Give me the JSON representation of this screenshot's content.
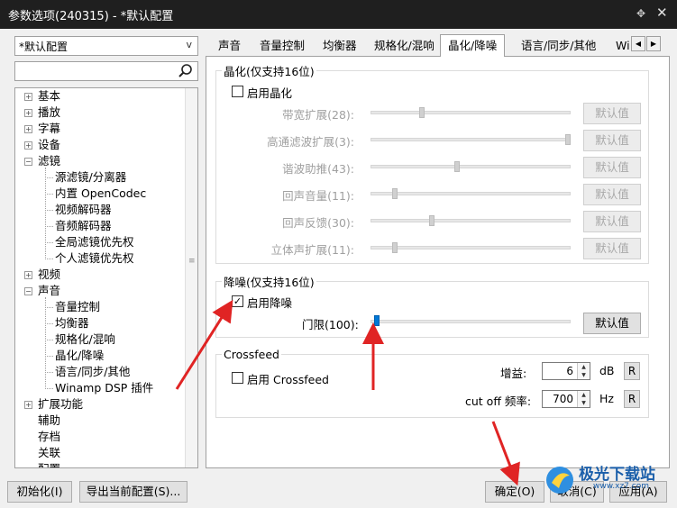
{
  "window": {
    "title": "参数选项(240315) - *默认配置",
    "pin_icon": "pin-icon",
    "close_icon": "close-icon"
  },
  "preset": {
    "value": "*默认配置"
  },
  "tree": {
    "items": [
      {
        "label": "基本",
        "expand": "+"
      },
      {
        "label": "播放",
        "expand": "+"
      },
      {
        "label": "字幕",
        "expand": "+"
      },
      {
        "label": "设备",
        "expand": "+"
      },
      {
        "label": "滤镜",
        "expand": "-"
      },
      {
        "label": "源滤镜/分离器"
      },
      {
        "label": "内置 OpenCodec"
      },
      {
        "label": "视频解码器"
      },
      {
        "label": "音频解码器"
      },
      {
        "label": "全局滤镜优先权"
      },
      {
        "label": "个人滤镜优先权"
      },
      {
        "label": "视频",
        "expand": "+"
      },
      {
        "label": "声音",
        "expand": "-"
      },
      {
        "label": "音量控制"
      },
      {
        "label": "均衡器"
      },
      {
        "label": "规格化/混响"
      },
      {
        "label": "晶化/降噪"
      },
      {
        "label": "语言/同步/其他"
      },
      {
        "label": "Winamp DSP 插件"
      },
      {
        "label": "扩展功能",
        "expand": "+"
      },
      {
        "label": "辅助"
      },
      {
        "label": "存档"
      },
      {
        "label": "关联"
      },
      {
        "label": "配置"
      }
    ]
  },
  "tabs": [
    {
      "label": "声音"
    },
    {
      "label": "音量控制"
    },
    {
      "label": "均衡器"
    },
    {
      "label": "规格化/混响"
    },
    {
      "label": "晶化/降噪",
      "active": true
    },
    {
      "label": "语言/同步/其他"
    },
    {
      "label": "Wi"
    }
  ],
  "crystal": {
    "legend": "晶化(仅支持16位)",
    "enable_label": "启用晶化",
    "enabled": false,
    "sliders": [
      {
        "label": "带宽扩展(28):",
        "value": 28,
        "pos": 0.25
      },
      {
        "label": "高通滤波扩展(3):",
        "value": 3,
        "pos": 1.0
      },
      {
        "label": "谐波助推(43):",
        "value": 43,
        "pos": 0.43
      },
      {
        "label": "回声音量(11):",
        "value": 11,
        "pos": 0.11
      },
      {
        "label": "回声反馈(30):",
        "value": 30,
        "pos": 0.3
      },
      {
        "label": "立体声扩展(11):",
        "value": 11,
        "pos": 0.11
      }
    ],
    "default_label": "默认值"
  },
  "denoise": {
    "legend": "降噪(仅支持16位)",
    "enable_label": "启用降噪",
    "enabled": true,
    "threshold_label": "门限(100):",
    "threshold_pos": 0.0,
    "default_label": "默认值"
  },
  "crossfeed": {
    "legend": "Crossfeed",
    "enable_label": "启用 Crossfeed",
    "enabled": false,
    "gain_label": "增益:",
    "gain_value": "6",
    "gain_unit": "dB",
    "cutoff_label": "cut off 频率:",
    "cutoff_value": "700",
    "cutoff_unit": "Hz",
    "reset_label": "R"
  },
  "footer": {
    "init_label": "初始化(I)",
    "export_label": "导出当前配置(S)...",
    "ok_label": "确定(O)",
    "cancel_label": "取消(C)",
    "apply_label": "应用(A)"
  },
  "watermark": {
    "text": "极光下载站",
    "url": "www.xz7.com"
  },
  "colors": {
    "titlebar": "#1f1f1f",
    "annotation_arrow": "#e02424",
    "slider_active": "#0078d7"
  }
}
